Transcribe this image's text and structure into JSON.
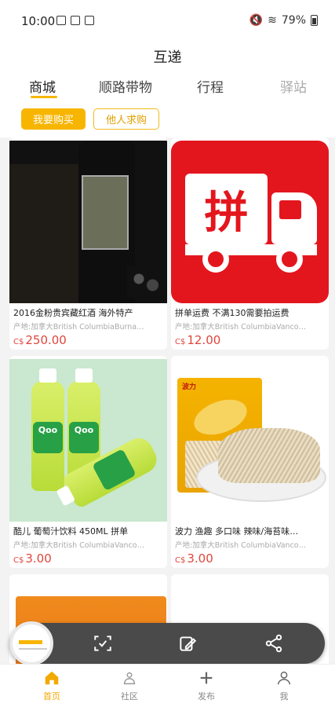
{
  "status_bar": {
    "time": "10:00",
    "battery": "79%"
  },
  "header": {
    "title": "互递",
    "tabs": [
      {
        "label": "商城"
      },
      {
        "label": "顺路带物"
      },
      {
        "label": "行程"
      },
      {
        "label": "驿站"
      }
    ],
    "chips": {
      "buy": "我要购买",
      "others": "他人求购"
    }
  },
  "products": [
    {
      "name": "2016金粉贵宾藏红酒 海外特产",
      "origin": "产地:加拿大British ColumbiaBurna…",
      "currency": "C$",
      "price": "250.00",
      "image": "wine-bottle-image"
    },
    {
      "name": "拼单运费 不满130需要拍运费",
      "origin": "产地:加拿大British ColumbiaVanco…",
      "currency": "C$",
      "price": "12.00",
      "image": "delivery-truck-image"
    },
    {
      "name": "酷儿 葡萄汁饮料 450ML 拼单",
      "origin": "产地:加拿大British ColumbiaVanco…",
      "currency": "C$",
      "price": "3.00",
      "image": "grape-juice-bottles-image"
    },
    {
      "name": "波力 渔趣 多口味 辣味/海苔味…",
      "origin": "产地:加拿大British ColumbiaVanco…",
      "currency": "C$",
      "price": "3.00",
      "image": "fish-snack-image"
    }
  ],
  "bottom_nav": [
    {
      "label": "首页",
      "icon": "home-icon",
      "active": true
    },
    {
      "label": "社区",
      "icon": "community-icon",
      "active": false
    },
    {
      "label": "发布",
      "icon": "plus-icon",
      "active": false
    },
    {
      "label": "我",
      "icon": "user-icon",
      "active": false
    }
  ],
  "floating_toolbar": {
    "icons": [
      "screenshot-thumbnail",
      "scan-icon",
      "edit-icon",
      "share-icon"
    ]
  },
  "colors": {
    "accent": "#f7b500",
    "price": "#e0463c"
  }
}
